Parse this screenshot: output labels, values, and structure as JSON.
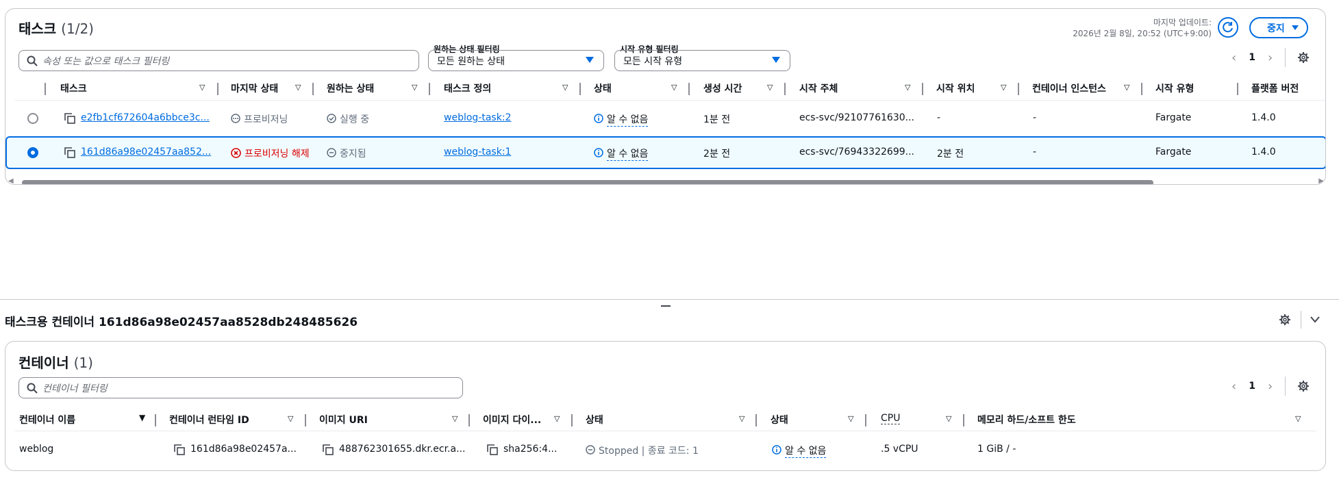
{
  "tasks_panel": {
    "title": "태스크",
    "count": "(1/2)",
    "last_updated_label": "마지막 업데이트:",
    "last_updated_value": "2026년 2월 8일, 20:52 (UTC+9:00)",
    "stop_button": "중지",
    "search_placeholder": "속성 또는 값으로 태스크 필터링",
    "desired_status_filter_label": "원하는 상태 필터링",
    "desired_status_filter_value": "모든 원하는 상태",
    "launch_type_filter_label": "시작 유형 필터링",
    "launch_type_filter_value": "모든 시작 유형",
    "page": "1",
    "columns": [
      "태스크",
      "마지막 상태",
      "원하는 상태",
      "태스크 정의",
      "상태",
      "생성 시간",
      "시작 주체",
      "시작 위치",
      "컨테이너 인스턴스",
      "시작 유형",
      "플랫폼 버전"
    ],
    "rows": [
      {
        "task": "e2fb1cf672604a6bbce3c...",
        "last_status": "프로비저닝",
        "desired_status": "실행 중",
        "task_definition": "weblog-task:2",
        "health": "알 수 없음",
        "created": "1분 전",
        "started_by": "ecs-svc/92107761630...",
        "started_at": "-",
        "container_instance": "-",
        "launch_type": "Fargate",
        "platform_version": "1.4.0"
      },
      {
        "task": "161d86a98e02457aa852...",
        "last_status": "프로비저닝 해제",
        "desired_status": "중지됨",
        "task_definition": "weblog-task:1",
        "health": "알 수 없음",
        "created": "2분 전",
        "started_by": "ecs-svc/76943322699...",
        "started_at": "2분 전",
        "container_instance": "-",
        "launch_type": "Fargate",
        "platform_version": "1.4.0"
      }
    ]
  },
  "split_panel": {
    "title": "태스크용 컨테이너 161d86a98e02457aa8528db248485626"
  },
  "containers_panel": {
    "title": "컨테이너",
    "count": "(1)",
    "search_placeholder": "컨테이너 필터링",
    "page": "1",
    "columns": [
      "컨테이너 이름",
      "컨테이너 런타임 ID",
      "이미지 URI",
      "이미지 다이...",
      "상태",
      "상태",
      "CPU",
      "메모리 하드/소프트 한도"
    ],
    "rows": [
      {
        "name": "weblog",
        "runtime_id": "161d86a98e02457a...",
        "image_uri": "488762301655.dkr.ecr.a...",
        "image_digest": "sha256:4...",
        "status": "Stopped | 종료 코드: 1",
        "health": "알 수 없음",
        "cpu": ".5 vCPU",
        "memory": "1 GiB / -"
      }
    ]
  },
  "colors": {
    "accent": "#006ce0",
    "error": "#db0000",
    "selected_row_bg": "#f0fbff",
    "border": "#c6c6cd"
  }
}
